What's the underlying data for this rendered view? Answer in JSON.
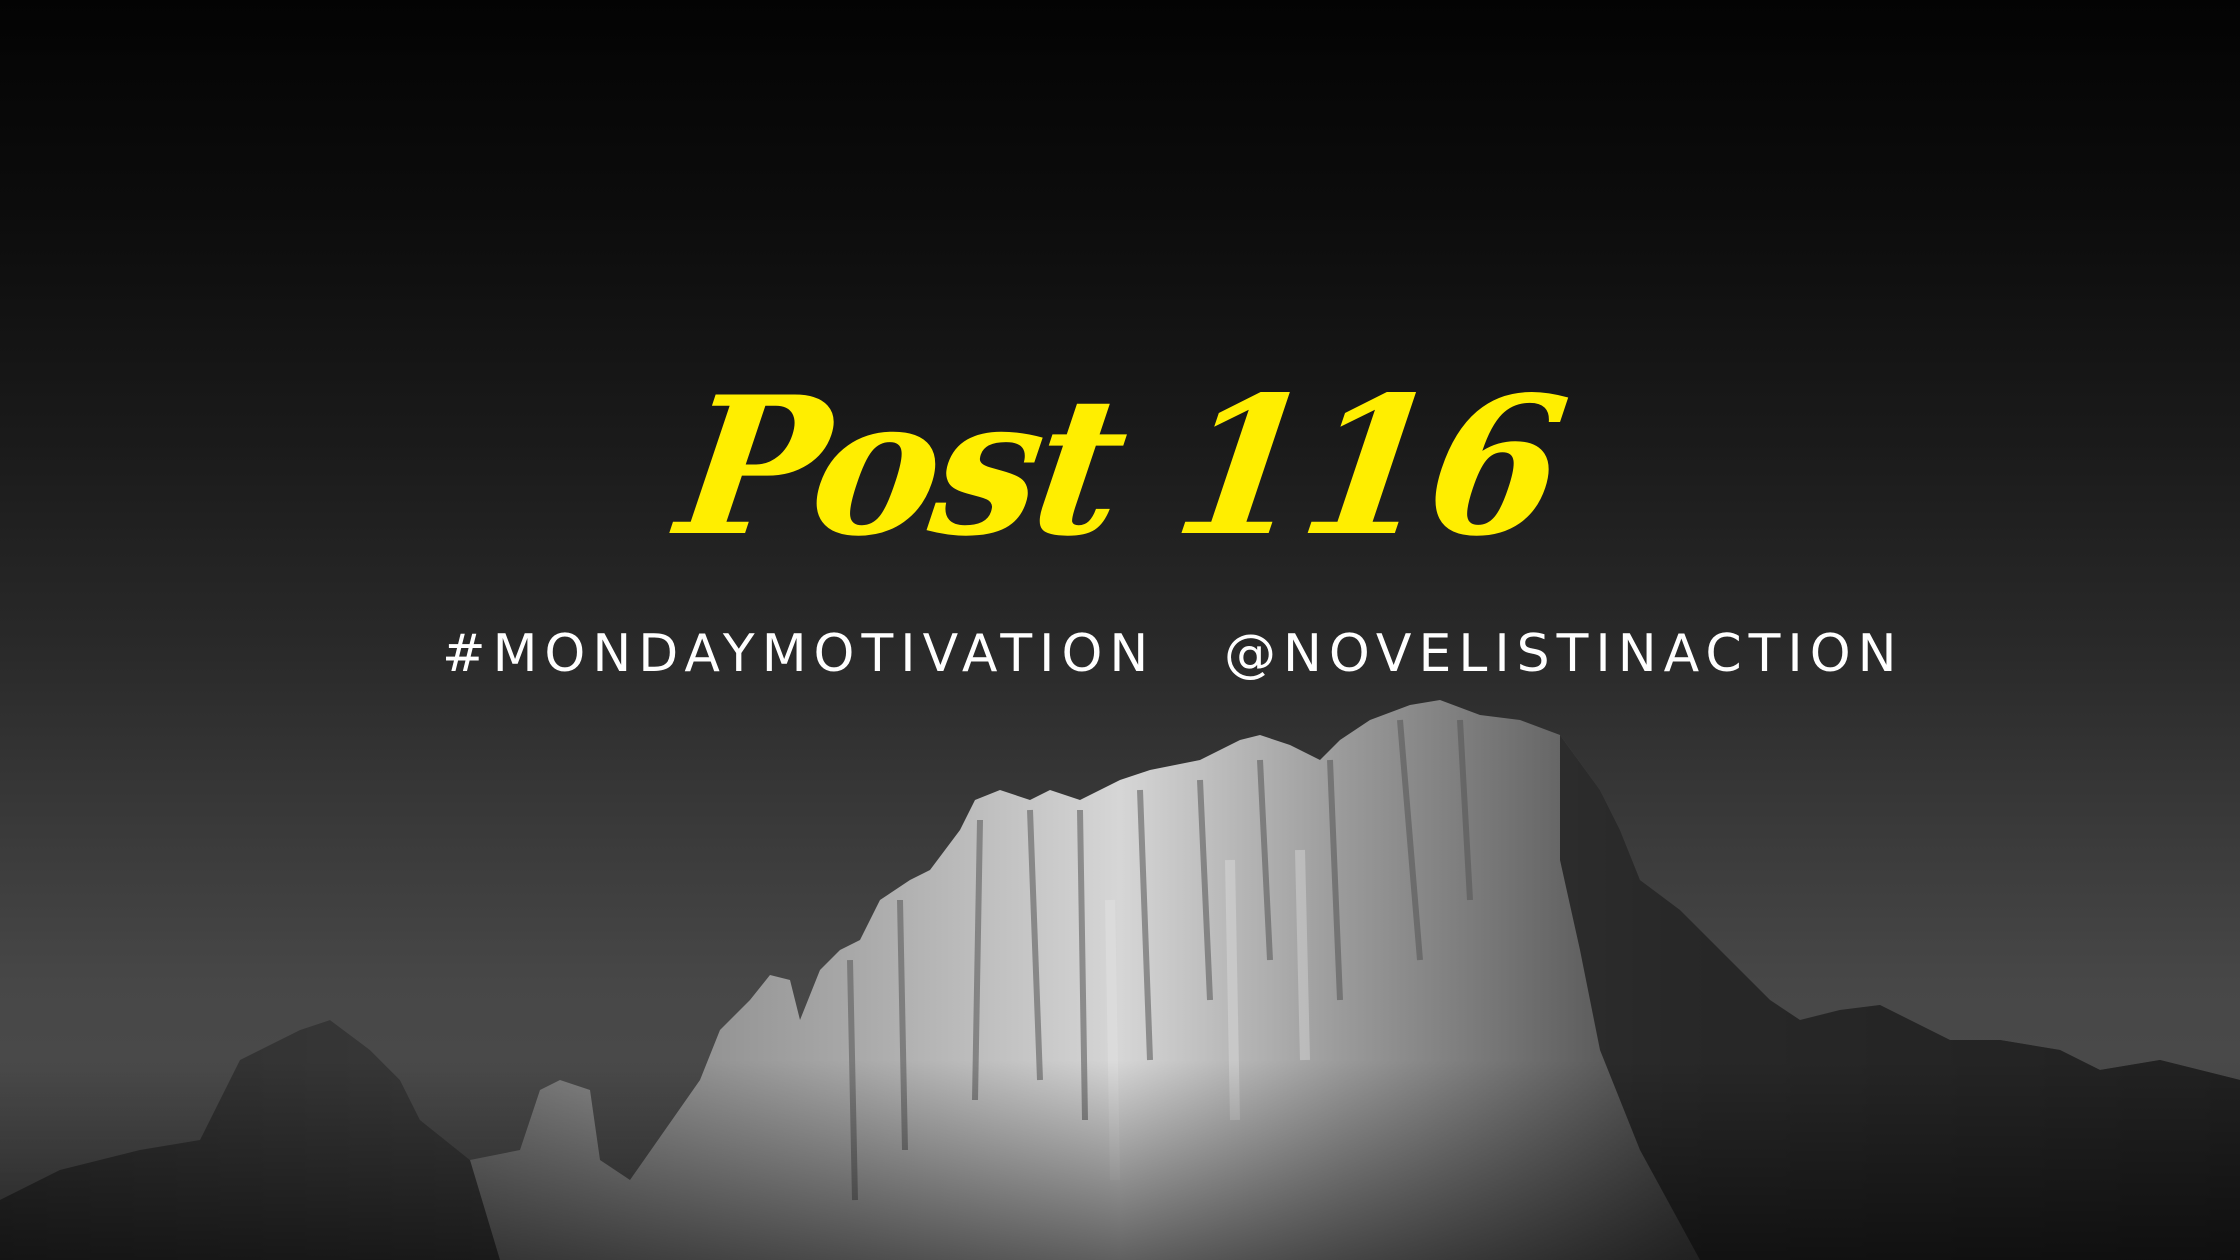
{
  "title": "Post 116",
  "hashtag": "#MONDAYMOTIVATION",
  "handle": "@NOVELISTINACTION",
  "colors": {
    "title": "#ffee00",
    "tagline": "#ffffff",
    "sky_top": "#030303",
    "sky_bottom": "#4f4f4f",
    "rock_light": "#d8d8d8",
    "rock_mid": "#8a8a8a",
    "rock_dark": "#2a2a2a"
  }
}
